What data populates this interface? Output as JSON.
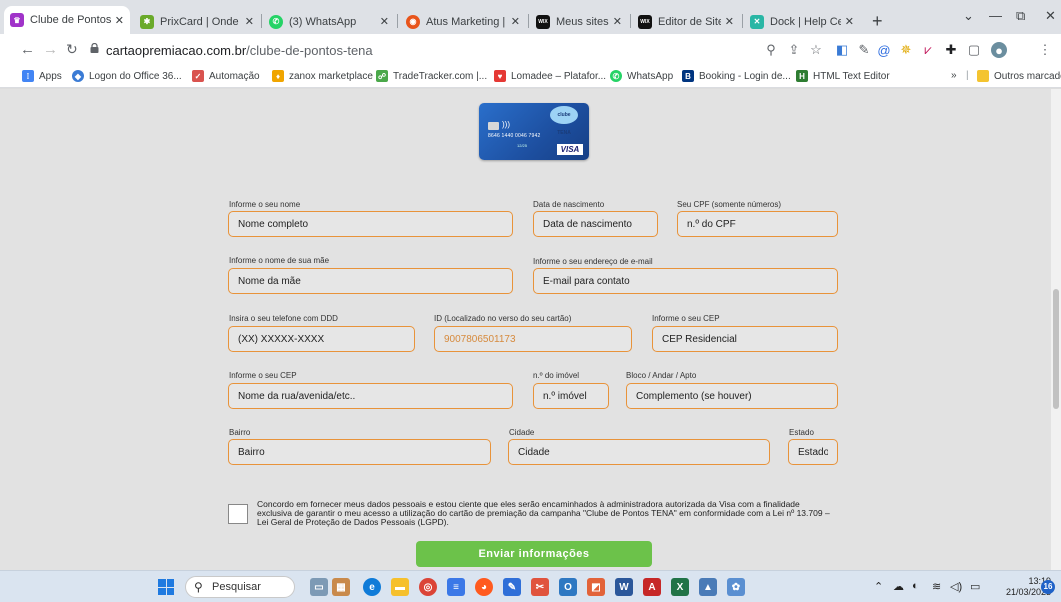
{
  "browser": {
    "tabs": [
      {
        "title": "Clube de Pontos",
        "color": "#a033c9",
        "glyph": "♛",
        "active": true
      },
      {
        "title": "PrixCard | Onde u",
        "color": "#6aaa2a",
        "glyph": "✱",
        "active": false
      },
      {
        "title": "(3) WhatsApp",
        "color": "#25d366",
        "glyph": "✆",
        "active": false
      },
      {
        "title": "Atus Marketing |",
        "color": "#e8541b",
        "glyph": "◉",
        "active": false
      },
      {
        "title": "Meus sites | Wix.c",
        "color": "#111111",
        "glyph": "WIX",
        "active": false
      },
      {
        "title": "Editor de Site Wi",
        "color": "#111111",
        "glyph": "WIX",
        "active": false
      },
      {
        "title": "Dock | Help Cent",
        "color": "#29b6a5",
        "glyph": "✕",
        "active": false
      }
    ],
    "address": {
      "domain": "cartaopremiacao.com.br",
      "path": "/clube-de-pontos-tena"
    },
    "bookmarks": [
      {
        "label": "Apps",
        "color": "#4285f4",
        "glyph": "⁞⁞"
      },
      {
        "label": "Logon do Office 36...",
        "color": "#3a7bd5",
        "glyph": "◆"
      },
      {
        "label": "Automação",
        "color": "#d9534f",
        "glyph": "✓"
      },
      {
        "label": "zanox marketplace",
        "color": "#f0a500",
        "glyph": "♦"
      },
      {
        "label": "TradeTracker.com |...",
        "color": "#4aa84a",
        "glyph": "☍"
      },
      {
        "label": "Lomadee – Platafor...",
        "color": "#e53935",
        "glyph": "♥"
      },
      {
        "label": "WhatsApp",
        "color": "#25d366",
        "glyph": "✆"
      },
      {
        "label": "Booking - Login de...",
        "color": "#003580",
        "glyph": "B"
      },
      {
        "label": "HTML Text Editor",
        "color": "#2e7d32",
        "glyph": "H"
      }
    ],
    "bookmarks_overflow": "»",
    "other_bookmarks": "Outros marcadores"
  },
  "card": {
    "logo_text": "clube TENA",
    "number": "8646 1440 0046 7942",
    "expiry": "12/25",
    "brand": "VISA"
  },
  "form": {
    "nome": {
      "label": "Informe o seu nome",
      "value": "Nome completo"
    },
    "nascimento": {
      "label": "Data de nascimento",
      "value": "Data de nascimento"
    },
    "cpf": {
      "label": "Seu CPF (somente números)",
      "value": "n.º do CPF"
    },
    "mae": {
      "label": "Informe o nome de sua mãe",
      "value": "Nome da mãe"
    },
    "email": {
      "label": "Informe o seu endereço de e-mail",
      "value": "E-mail para contato"
    },
    "telefone": {
      "label": "Insira o seu telefone com DDD",
      "value": "(XX) XXXXX-XXXX"
    },
    "id_cartao": {
      "label": "ID (Localizado no verso do seu cartão)",
      "value": "9007806501173"
    },
    "cep": {
      "label": "Informe o seu CEP",
      "value": "CEP Residencial"
    },
    "rua": {
      "label": "Informe o seu CEP",
      "value": "Nome da rua/avenida/etc.."
    },
    "numero": {
      "label": "n.º do imóvel",
      "value": "n.º imóvel"
    },
    "complemento": {
      "label": "Bloco / Andar / Apto",
      "value": "Complemento (se houver)"
    },
    "bairro": {
      "label": "Bairro",
      "value": "Bairro"
    },
    "cidade": {
      "label": "Cidade",
      "value": "Cidade"
    },
    "estado": {
      "label": "Estado",
      "value": "Estado"
    },
    "consent_text": "Concordo em fornecer meus dados pessoais e estou ciente que eles serão encaminhados à administradora autorizada da Visa com a finalidade exclusiva de garantir o meu acesso a utilização do cartão de premiação da campanha \"Clube de Pontos TENA\" em conformidade com a Lei nº 13.709 – Lei Geral de Proteção de Dados Pessoais (LGPD).",
    "consent_checked": false,
    "submit_label": "Enviar informações"
  },
  "taskbar": {
    "search_placeholder": "Pesquisar",
    "time": "13:19",
    "date": "21/03/2023",
    "notification_count": "16"
  }
}
